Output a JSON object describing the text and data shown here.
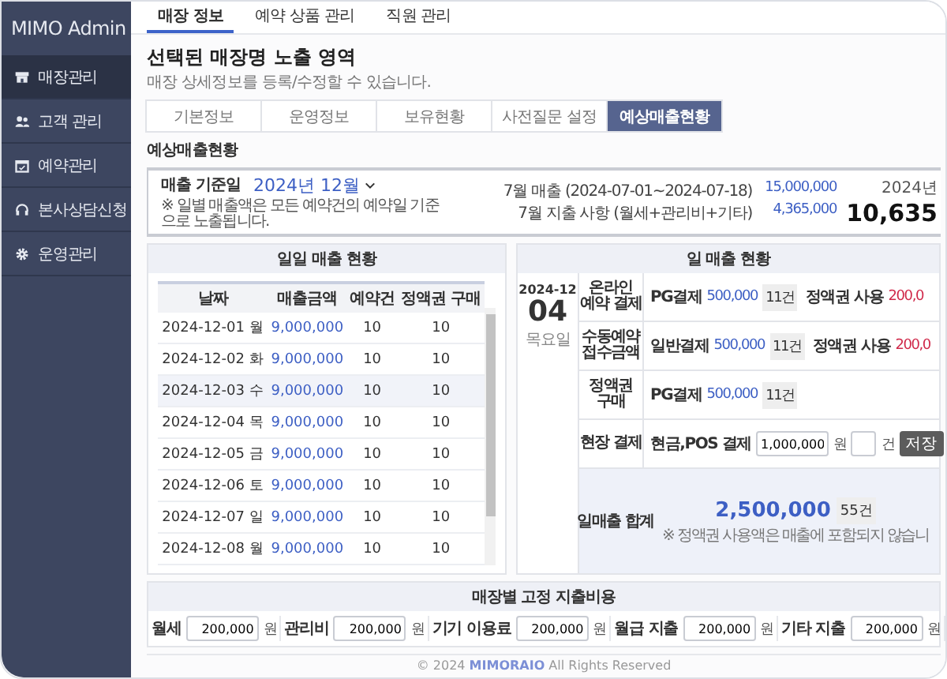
{
  "sidebar": {
    "logo": "MIMO Admin",
    "items": [
      {
        "label": "매장관리",
        "selected": true
      },
      {
        "label": "고객 관리",
        "selected": false
      },
      {
        "label": "예약관리",
        "selected": false
      },
      {
        "label": "본사상담신청",
        "selected": false
      },
      {
        "label": "운영관리",
        "selected": false
      }
    ]
  },
  "top_tabs": [
    {
      "label": "매장 정보",
      "selected": true
    },
    {
      "label": "예약 상품 관리",
      "selected": false
    },
    {
      "label": "직원 관리",
      "selected": false
    }
  ],
  "page": {
    "title": "선택된 매장명 노출 영역",
    "subtitle": "매장 상세정보를 등록/수정할 수 있습니다."
  },
  "sub_tabs": [
    {
      "label": "기본정보",
      "selected": false
    },
    {
      "label": "운영정보",
      "selected": false
    },
    {
      "label": "보유현황",
      "selected": false
    },
    {
      "label": "사전질문 설정",
      "selected": false
    },
    {
      "label": "예상매출현황",
      "selected": true
    }
  ],
  "section_title": "예상매출현황",
  "summary": {
    "date_label": "매출 기준일",
    "month": "2024년 12월",
    "note": "※ 일별 매출액은 모든 예약건의 예약일 기준으로 노출됩니다.",
    "lines": [
      {
        "label": "7월 매출 (2024-07-01~2024-07-18)",
        "value": "15,000,000"
      },
      {
        "label": "7월 지출 사항 (월세+관리비+기타)",
        "value": "4,365,000"
      }
    ],
    "year": "2024년",
    "total": "10,635"
  },
  "daily_table": {
    "title": "일일 매출 현황",
    "columns": [
      "날짜",
      "매출금액",
      "예약건",
      "정액권 구매"
    ],
    "rows": [
      {
        "cells": [
          "2024-12-01 월",
          "9,000,000",
          "10",
          "10"
        ],
        "selected": false
      },
      {
        "cells": [
          "2024-12-02 화",
          "9,000,000",
          "10",
          "10"
        ],
        "selected": false
      },
      {
        "cells": [
          "2024-12-03 수",
          "9,000,000",
          "10",
          "10"
        ],
        "selected": true
      },
      {
        "cells": [
          "2024-12-04 목",
          "9,000,000",
          "10",
          "10"
        ],
        "selected": false
      },
      {
        "cells": [
          "2024-12-05 금",
          "9,000,000",
          "10",
          "10"
        ],
        "selected": false
      },
      {
        "cells": [
          "2024-12-06 토",
          "9,000,000",
          "10",
          "10"
        ],
        "selected": false
      },
      {
        "cells": [
          "2024-12-07 일",
          "9,000,000",
          "10",
          "10"
        ],
        "selected": false
      },
      {
        "cells": [
          "2024-12-08 월",
          "9,000,000",
          "10",
          "10"
        ],
        "selected": false
      }
    ]
  },
  "day_sales": {
    "title": "일 매출 현황",
    "year_month": "2024-12",
    "day": "04",
    "weekday": "목요일",
    "rows": [
      {
        "kind": "payment",
        "label": "온라인 예약 결제",
        "method": "PG결제",
        "amount": "500,000",
        "count": "11건",
        "usage_label": "정액권 사용",
        "usage_amount": "200,0"
      },
      {
        "kind": "payment",
        "label": "수동예약 접수금액",
        "method": "일반결제",
        "amount": "500,000",
        "count": "11건",
        "usage_label": "정액권 사용",
        "usage_amount": "200,0"
      },
      {
        "kind": "payment",
        "label": "정액권 구매",
        "method": "PG결제",
        "amount": "500,000",
        "count": "11건"
      },
      {
        "kind": "onsite",
        "label": "현장 결제",
        "method": "현금,POS 결제",
        "amount": "1,000,000",
        "amount_unit": "원",
        "count_unit": "건",
        "button": "저장"
      }
    ],
    "total": {
      "label": "일매출 합계",
      "amount": "2,500,000",
      "count": "55건",
      "note": "※ 정액권 사용액은 매출에 포함되지 않습니"
    }
  },
  "fixed_costs": {
    "title": "매장별 고정 지출비용",
    "items": [
      {
        "label": "월세",
        "value": "200,000",
        "unit": "원"
      },
      {
        "label": "관리비",
        "value": "200,000",
        "unit": "원"
      },
      {
        "label": "기기 이용료",
        "value": "200,000",
        "unit": "원"
      },
      {
        "label": "월급 지출",
        "value": "200,000",
        "unit": "원"
      },
      {
        "label": "기타 지출",
        "value": "200,000",
        "unit": "원"
      }
    ]
  },
  "footer": "© 2024 **MIMORAIO** All Rights Reserved"
}
